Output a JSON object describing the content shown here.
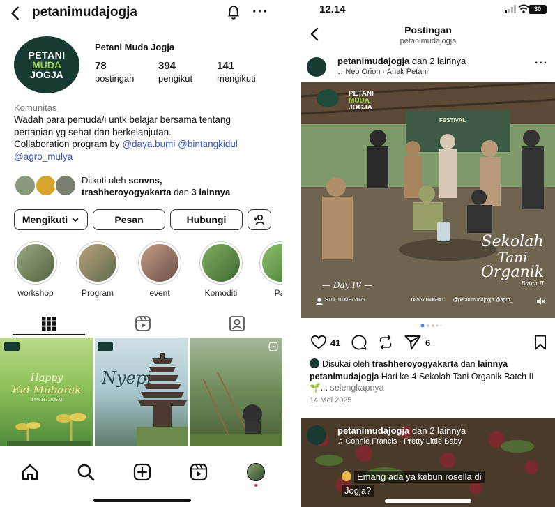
{
  "left": {
    "header": {
      "username": "petanimudajogja"
    },
    "profile": {
      "avatar_lines": [
        "PETANI",
        "MUDA",
        "JOGJA"
      ],
      "name": "Petani Muda Jogja",
      "stats": [
        {
          "value": "78",
          "label": "postingan"
        },
        {
          "value": "394",
          "label": "pengikut"
        },
        {
          "value": "141",
          "label": "mengikuti"
        }
      ],
      "category": "Komunitas",
      "bio_line1": "Wadah para pemuda/i untk belajar bersama tentang",
      "bio_line2": "pertanian yg sehat dan berkelanjutan.",
      "bio_line3_prefix": "Collaboration program by ",
      "mentions": [
        "@daya.bumi",
        "@bintangkidul",
        "@agro_mulya"
      ]
    },
    "followed_by": {
      "prefix": "Diikuti oleh ",
      "user1": "scnvns,",
      "user2": "trashheroyogyakarta",
      "middle": " dan ",
      "rest": "3 lainnya"
    },
    "buttons": {
      "following": "Mengikuti",
      "message": "Pesan",
      "contact": "Hubungi"
    },
    "highlights": [
      {
        "label": "workshop",
        "color": "#7a8a62"
      },
      {
        "label": "Program",
        "color": "#8a7a5a"
      },
      {
        "label": "event",
        "color": "#a07a6a"
      },
      {
        "label": "Komoditi",
        "color": "#5a8a4a"
      },
      {
        "label": "Par",
        "color": "#6a9a5a"
      }
    ],
    "grid": {
      "eid_line1": "Happy",
      "eid_line2": "Eid Mubarak",
      "eid_small": "1446 H / 2025 M",
      "nyepi": "Nyepi"
    }
  },
  "right": {
    "status": {
      "time": "12.14",
      "battery": "30"
    },
    "header": {
      "title": "Postingan",
      "subtitle": "petanimudajogja"
    },
    "post": {
      "user": "petanimudajogja",
      "others": " dan 2 lainnya",
      "music": "Neo Orion · Anak Petani",
      "photo_day": "— Day IV —",
      "photo_date": "STU, 10 MEI 2025",
      "photo_phone": "089671606941",
      "photo_handle": "@petanimudajogja @agro_",
      "photo_title1": "Sekolah",
      "photo_title2": "Tani",
      "photo_title3": "Organik",
      "photo_batch": "Batch II",
      "photo_banner": "FESTIVAL",
      "likes": "41",
      "shares": "6",
      "liked_prefix": "Disukai oleh ",
      "liked_user": "trashheroyogyakarta",
      "liked_mid": " dan ",
      "liked_rest": "lainnya",
      "caption_user": "petanimudajogja",
      "caption_text": " Hari ke-4 Sekolah Tani Organik Batch II 🌱... ",
      "caption_more": "selengkapnya",
      "date": "14 Mei 2025"
    },
    "next_post": {
      "user": "petanimudajogja",
      "others": " dan 2 lainnya",
      "music": "Connie Francis · Pretty Little Baby",
      "text_line1": "Emang ada ya kebun rosella di",
      "text_line2": "Jogja?"
    }
  }
}
